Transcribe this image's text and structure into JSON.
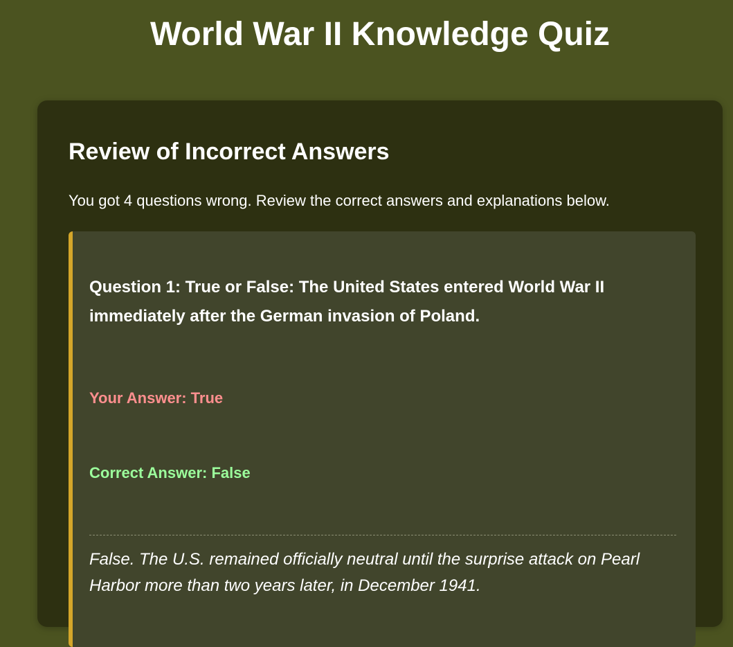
{
  "page": {
    "title": "World War II Knowledge Quiz"
  },
  "review": {
    "heading": "Review of Incorrect Answers",
    "summary": "You got 4 questions wrong. Review the correct answers and explanations below."
  },
  "questions": [
    {
      "question": "Question 1: True or False: The United States entered World War II immediately after the German invasion of Poland.",
      "your_answer": "Your Answer: True",
      "correct_answer": "Correct Answer: False",
      "explanation": "False. The U.S. remained officially neutral until the surprise attack on Pearl Harbor more than two years later, in December 1941."
    }
  ],
  "colors": {
    "background": "#4b5320",
    "panel": "#2d3011",
    "card": "#41452c",
    "accent": "#d4a62a",
    "incorrect": "#ff8f8f",
    "correct": "#9cff9c"
  }
}
